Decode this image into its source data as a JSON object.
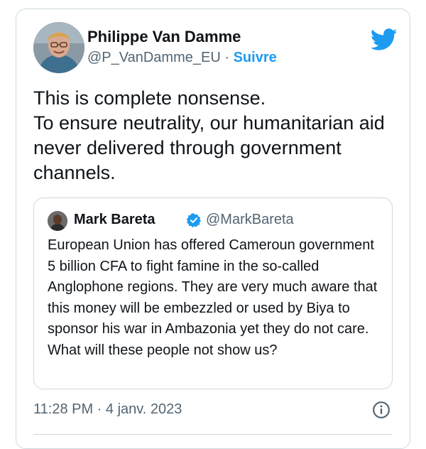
{
  "tweet": {
    "author_name": "Philippe Van Damme",
    "author_handle": "@P_VanDamme_EU",
    "separator": " · ",
    "follow_label": "Suivre",
    "text": "This is complete nonsense.\nTo ensure neutrality, our humanitarian aid never delivered through government channels.",
    "timestamp": "11:28 PM · 4 janv. 2023",
    "icons": {
      "brand": "twitter-bird-icon",
      "info": "info-icon",
      "verified": "verified-badge-icon"
    },
    "colors": {
      "accent": "#1d9bf0",
      "secondary_text": "#536471",
      "border": "#cfd9de"
    }
  },
  "quoted_tweet": {
    "author_name": "Mark Bareta",
    "author_handle": "@MarkBareta",
    "text": "European Union has offered Cameroun government 5 billion CFA to fight famine in the so-called Anglophone regions. They are very much aware that this money will be embezzled or used by Biya to sponsor his war in Ambazonia yet they do not care. What will these people not show us?"
  }
}
